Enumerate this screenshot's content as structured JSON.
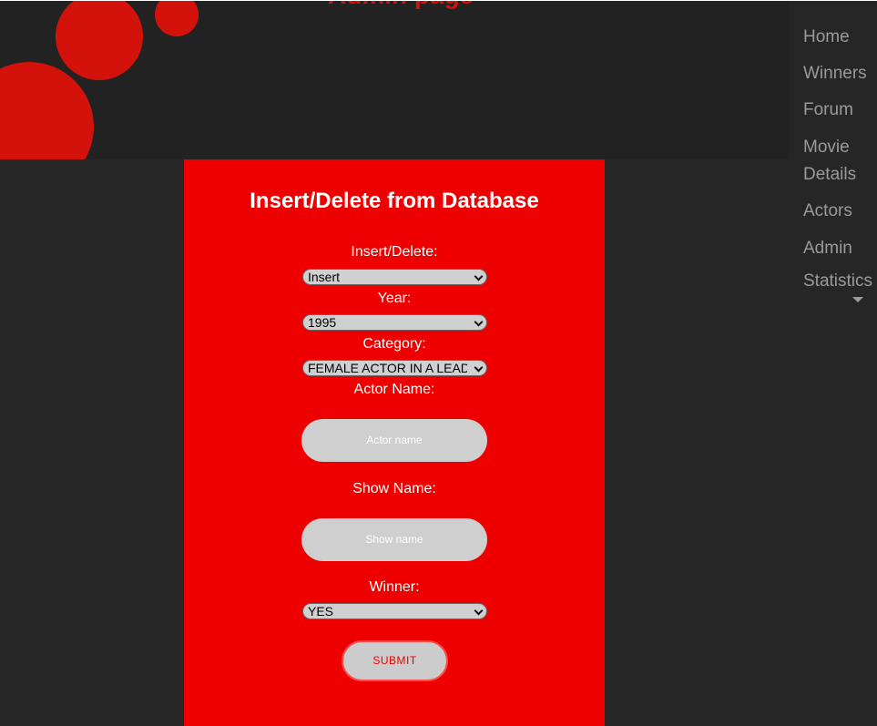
{
  "header": {
    "title": "Admin page"
  },
  "nav": {
    "items": [
      "Home",
      "Winners",
      "Forum",
      "Movie Details",
      "Actors",
      "Admin",
      "Statistics"
    ]
  },
  "form": {
    "heading": "Insert/Delete from Database",
    "action_label": "Insert/Delete:",
    "action_value": "Insert",
    "year_label": "Year:",
    "year_value": "1995",
    "category_label": "Category:",
    "category_value": "FEMALE ACTOR IN A LEADING ROLE",
    "actor_label": "Actor Name:",
    "actor_placeholder": "Actor name",
    "show_label": "Show Name:",
    "show_placeholder": "Show name",
    "winner_label": "Winner:",
    "winner_value": "YES",
    "submit_label": "SUBMIT"
  },
  "colors": {
    "accent": "#ef0000",
    "circles": "#d3120b",
    "background": "#262626",
    "header": "#222222"
  }
}
